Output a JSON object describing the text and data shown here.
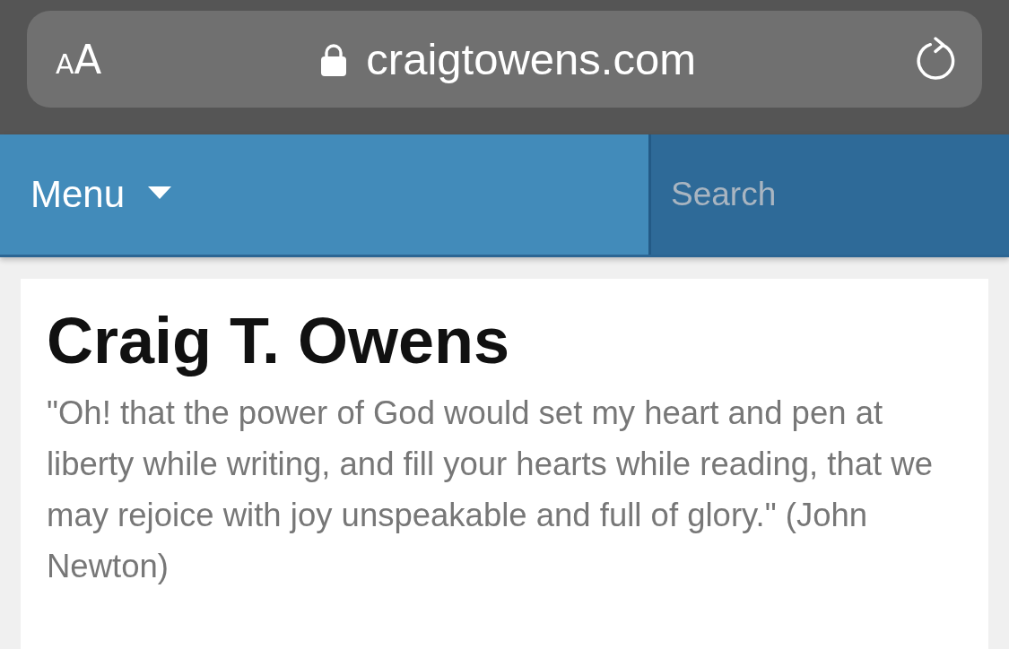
{
  "browser": {
    "text_size_button": "AA",
    "url": "craigtowens.com"
  },
  "nav": {
    "menu_label": "Menu",
    "search": {
      "placeholder": "Search"
    }
  },
  "page": {
    "title": "Craig T. Owens",
    "quote": "\"Oh! that the power of God would set my heart and pen at liberty while writing, and fill your hearts while reading, that we may rejoice with joy unspeakable and full of glory.\" (John Newton)"
  }
}
